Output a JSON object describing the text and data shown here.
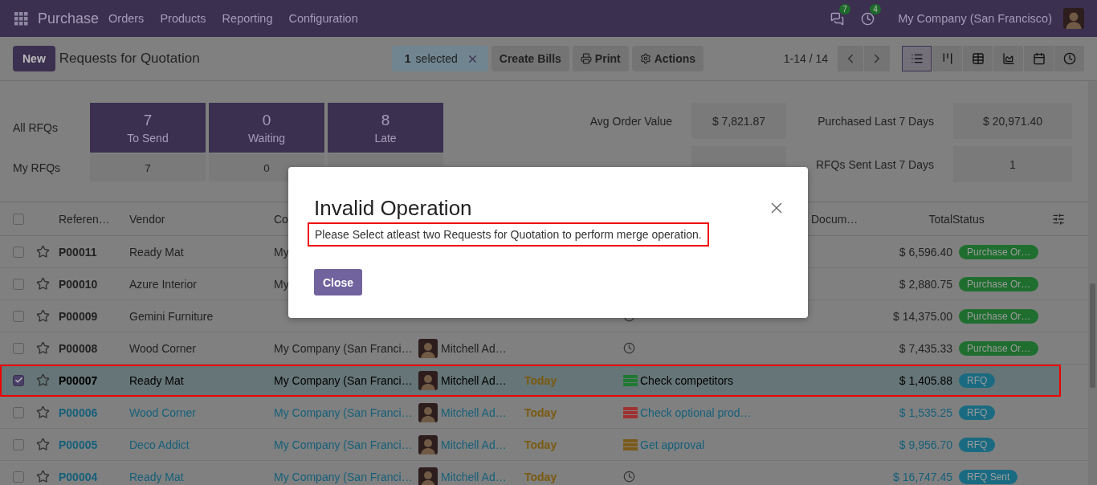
{
  "navbar": {
    "app": "Purchase",
    "menu": [
      "Orders",
      "Products",
      "Reporting",
      "Configuration"
    ],
    "messages_count": "7",
    "activities_count": "4",
    "company": "My Company (San Francisco)"
  },
  "control_panel": {
    "new_button": "New",
    "title": "Requests for Quotation",
    "selection": {
      "count": "1",
      "label": "selected"
    },
    "actions": [
      {
        "label": "Create Bills",
        "kind": "plain"
      },
      {
        "label": "Print",
        "kind": "print"
      },
      {
        "label": "Actions",
        "kind": "gear"
      }
    ],
    "pager": "1-14 / 14",
    "views": [
      {
        "kind": "list",
        "selected": true
      },
      {
        "kind": "kanban",
        "selected": false
      },
      {
        "kind": "pivot",
        "selected": false
      },
      {
        "kind": "graph",
        "selected": false
      },
      {
        "kind": "calendar",
        "selected": false
      },
      {
        "kind": "activity",
        "selected": false
      }
    ]
  },
  "dashboard": {
    "rows": [
      {
        "label": "All RFQs",
        "tiles": [
          {
            "value": "7",
            "caption": "To Send"
          },
          {
            "value": "0",
            "caption": "Waiting"
          },
          {
            "value": "8",
            "caption": "Late"
          }
        ]
      },
      {
        "label": "My RFQs",
        "tiles": [
          {
            "value": "7"
          },
          {
            "value": "0"
          }
        ]
      }
    ],
    "stats": [
      {
        "left": {
          "label": "Avg Order Value",
          "value": "$ 7,821.87"
        },
        "right": {
          "label": "Purchased Last 7 Days",
          "value": "$ 20,971.40"
        }
      },
      {
        "right": {
          "label": "RFQs Sent Last 7 Days",
          "value": "1"
        }
      }
    ]
  },
  "table": {
    "all_selected": false,
    "columns": [
      {
        "label": "Referen…",
        "kind": "reference"
      },
      {
        "label": "Vendor",
        "kind": "vendor"
      },
      {
        "label": "Co",
        "kind": "company"
      },
      {
        "label": "Docum…",
        "kind": "source"
      },
      {
        "label": "Total",
        "kind": "total"
      },
      {
        "label": "Status",
        "kind": "status"
      }
    ],
    "rows": [
      {
        "reference": "P00011",
        "vendor": "Ready Mat",
        "company": "My",
        "total": "$ 6,596.40",
        "status": {
          "label": "Purchase Or…",
          "color": "#1f6e2f"
        },
        "kind": "order",
        "selected": false
      },
      {
        "reference": "P00010",
        "vendor": "Azure Interior",
        "company": "My",
        "total": "$ 2,880.75",
        "status": {
          "label": "Purchase Or…",
          "color": "#1f6e2f"
        },
        "kind": "order",
        "selected": false
      },
      {
        "reference": "P00009",
        "vendor": "Gemini Furniture",
        "activity": {
          "kind": "clock"
        },
        "total": "$ 14,375.00",
        "status": {
          "label": "Purchase Or…",
          "color": "#1f6e2f"
        },
        "kind": "order",
        "selected": false
      },
      {
        "reference": "P00008",
        "vendor": "Wood Corner",
        "company": "My Company (San Franci…",
        "buyer": "Mitchell Ad…",
        "activity": {
          "kind": "clock"
        },
        "total": "$ 7,435.33",
        "status": {
          "label": "Purchase Or…",
          "color": "#1f6e2f"
        },
        "kind": "order",
        "selected": false
      },
      {
        "reference": "P00007",
        "vendor": "Ready Mat",
        "company": "My Company (San Franci…",
        "buyer": "Mitchell Ad…",
        "deadline": "Today",
        "activity": {
          "kind": "todo",
          "text": "Check competitors",
          "color": "#1e7a30"
        },
        "total": "$ 1,405.88",
        "status": {
          "label": "RFQ",
          "color": "#1a6b82"
        },
        "kind": "rfq",
        "selected": true,
        "annotated": true
      },
      {
        "reference": "P00006",
        "vendor": "Wood Corner",
        "company": "My Company (San Franci…",
        "buyer": "Mitchell Ad…",
        "deadline": "Today",
        "activity": {
          "kind": "todo",
          "text": "Check optional prod…",
          "color": "#a03030"
        },
        "total": "$ 1,535.25",
        "status": {
          "label": "RFQ",
          "color": "#1a6b82"
        },
        "kind": "rfq",
        "selected": false
      },
      {
        "reference": "P00005",
        "vendor": "Deco Addict",
        "company": "My Company (San Franci…",
        "buyer": "Mitchell Ad…",
        "deadline": "Today",
        "activity": {
          "kind": "todo",
          "text": "Get approval",
          "color": "#7a5a1a"
        },
        "total": "$ 9,956.70",
        "status": {
          "label": "RFQ",
          "color": "#1a6b82"
        },
        "kind": "rfq",
        "selected": false
      },
      {
        "reference": "P00004",
        "vendor": "Ready Mat",
        "company": "My Company (San Franci…",
        "buyer": "Mitchell Ad…",
        "deadline": "Today",
        "activity": {
          "kind": "clock"
        },
        "total": "$ 16,747.45",
        "status": {
          "label": "RFQ Sent",
          "color": "#1a6b82"
        },
        "kind": "rfq",
        "selected": false
      }
    ]
  },
  "dialog": {
    "title": "Invalid Operation",
    "message": "Please Select atleast two Requests for Quotation to perform merge operation.",
    "message_annotated": true,
    "button": "Close"
  }
}
